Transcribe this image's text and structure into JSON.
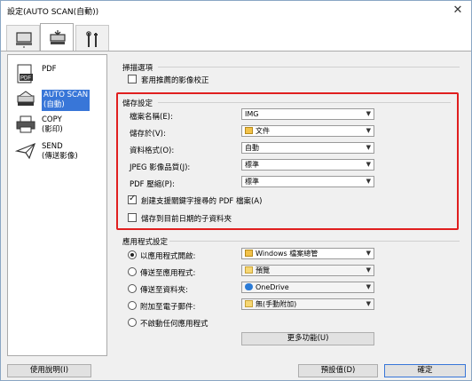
{
  "window": {
    "title": "設定(AUTO SCAN(自動))",
    "close_glyph": "✕"
  },
  "tabs": [
    {
      "icon": "computer-scan-icon"
    },
    {
      "icon": "scanner-icon"
    },
    {
      "icon": "tools-icon"
    }
  ],
  "sidebar": {
    "items": [
      {
        "label": "PDF",
        "icon": "pdf-icon"
      },
      {
        "label": "AUTO SCAN\n(自動)",
        "icon": "scanner-icon"
      },
      {
        "label": "COPY\n(影印)",
        "icon": "printer-icon"
      },
      {
        "label": "SEND\n(傳送影像)",
        "icon": "send-icon"
      }
    ]
  },
  "scan_options": {
    "title": "掃描選項",
    "recommended_correction": "套用推薦的影像校正"
  },
  "save_settings": {
    "title": "儲存設定",
    "file_name": {
      "label": "檔案名稱(E):",
      "value": "IMG"
    },
    "save_in": {
      "label": "儲存於(V):",
      "value": "文件"
    },
    "data_format": {
      "label": "資料格式(O):",
      "value": "自動"
    },
    "jpeg_quality": {
      "label": "JPEG 影像品質(J):",
      "value": "標準"
    },
    "pdf_compression": {
      "label": "PDF 壓縮(P):",
      "value": "標準"
    },
    "create_searchable_pdf": "創建支援關鍵字搜尋的 PDF 檔案(A)",
    "save_to_subfolder": "儲存到目前日期的子資料夾"
  },
  "app_settings": {
    "title": "應用程式設定",
    "open_with": {
      "label": "以應用程式開啟:",
      "value": "Windows 檔案總管"
    },
    "send_to_app": {
      "label": "傳送至應用程式:",
      "value": "預覽"
    },
    "send_to_folder": {
      "label": "傳送至資料夾:",
      "value": "OneDrive"
    },
    "attach_email": {
      "label": "附加至電子郵件:",
      "value": "無(手動附加)"
    },
    "no_app": {
      "label": "不啟動任何應用程式"
    },
    "more_functions": "更多功能(U)"
  },
  "footer": {
    "help": "使用說明(I)",
    "defaults": "預設值(D)",
    "ok": "確定"
  },
  "colors": {
    "highlight": "#e01f1f",
    "selection": "#3876d8"
  }
}
